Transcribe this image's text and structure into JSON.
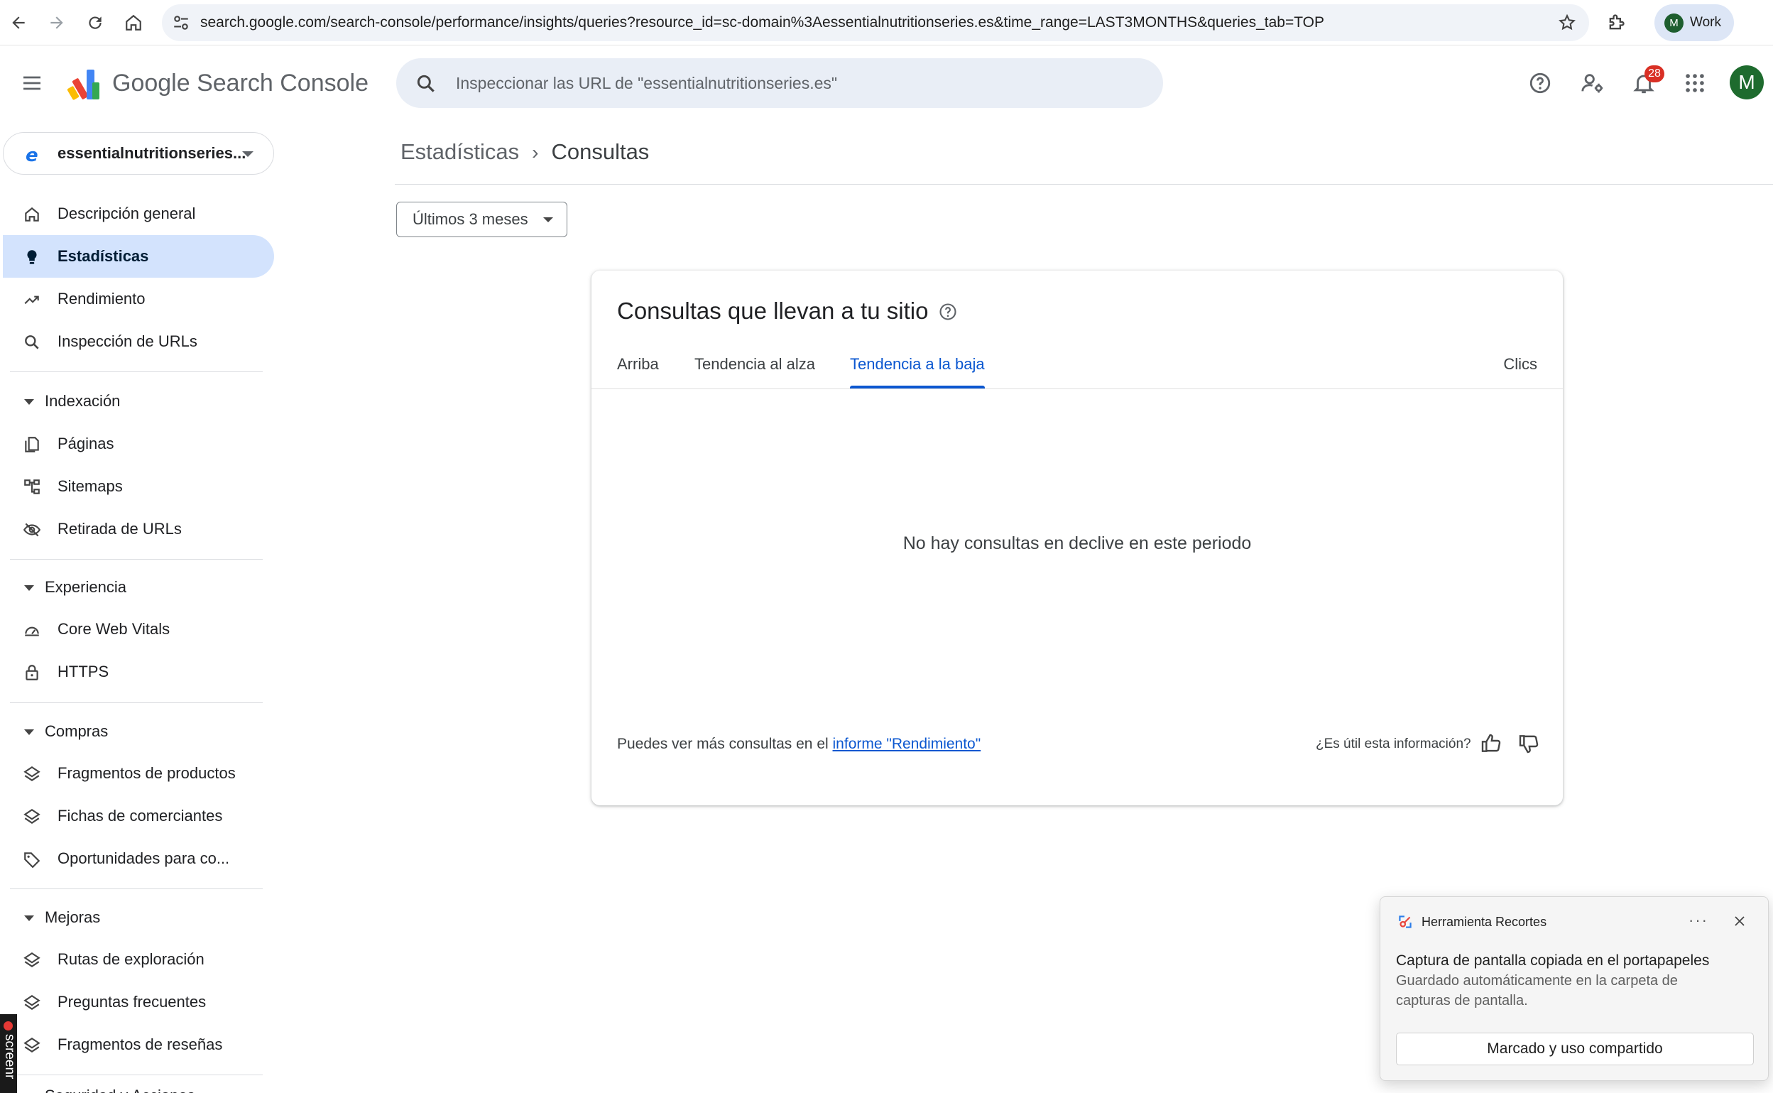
{
  "browser": {
    "url": "search.google.com/search-console/performance/insights/queries?resource_id=sc-domain%3Aessentialnutritionseries.es&time_range=LAST3MONTHS&queries_tab=TOP",
    "profile_initial": "M",
    "profile_label": "Work"
  },
  "header": {
    "product_name": "Google Search Console",
    "search_placeholder": "Inspeccionar las URL de \"essentialnutritionseries.es\"",
    "notification_count": "28",
    "user_initial": "M"
  },
  "sidebar": {
    "property_name": "essentialnutritionseries...",
    "items_top": [
      {
        "label": "Descripción general",
        "icon": "home-icon"
      },
      {
        "label": "Estadísticas",
        "icon": "lightbulb-icon",
        "active": true
      },
      {
        "label": "Rendimiento",
        "icon": "trending-up-icon"
      },
      {
        "label": "Inspección de URLs",
        "icon": "search-icon"
      }
    ],
    "sections": [
      {
        "title": "Indexación",
        "items": [
          {
            "label": "Páginas",
            "icon": "pages-icon"
          },
          {
            "label": "Sitemaps",
            "icon": "sitemap-icon"
          },
          {
            "label": "Retirada de URLs",
            "icon": "eye-off-icon"
          }
        ]
      },
      {
        "title": "Experiencia",
        "items": [
          {
            "label": "Core Web Vitals",
            "icon": "speedometer-icon"
          },
          {
            "label": "HTTPS",
            "icon": "lock-icon"
          }
        ]
      },
      {
        "title": "Compras",
        "items": [
          {
            "label": "Fragmentos de productos",
            "icon": "layers-icon"
          },
          {
            "label": "Fichas de comerciantes",
            "icon": "layers-icon"
          },
          {
            "label": "Oportunidades para co...",
            "icon": "tag-icon"
          }
        ]
      },
      {
        "title": "Mejoras",
        "items": [
          {
            "label": "Rutas de exploración",
            "icon": "layers-icon"
          },
          {
            "label": "Preguntas frecuentes",
            "icon": "layers-icon"
          },
          {
            "label": "Fragmentos de reseñas",
            "icon": "layers-icon"
          }
        ]
      },
      {
        "title": "Seguridad y Acciones",
        "items": []
      }
    ],
    "recorder_label": "screenr"
  },
  "main": {
    "breadcrumb": [
      "Estadísticas",
      "Consultas"
    ],
    "date_range": "Últimos 3 meses",
    "card": {
      "title": "Consultas que llevan a tu sitio",
      "tabs": [
        "Arriba",
        "Tendencia al alza",
        "Tendencia a la baja"
      ],
      "active_tab": 2,
      "metric_label": "Clics",
      "empty_message": "No hay consultas en declive en este periodo",
      "footer_text": "Puedes ver más consultas en el",
      "footer_link": "informe \"Rendimiento\"",
      "feedback_question": "¿Es útil esta información?"
    }
  },
  "toast": {
    "app_name": "Herramienta Recortes",
    "more": "···",
    "heading": "Captura de pantalla copiada en el portapapeles",
    "body": "Guardado automáticamente en la carpeta de capturas de pantalla.",
    "button": "Marcado y uso compartido"
  },
  "colors": {
    "accent": "#0b57d0",
    "active_nav_bg": "#d3e3fd",
    "search_bg": "#e9eef6",
    "badge": "#d93025"
  }
}
